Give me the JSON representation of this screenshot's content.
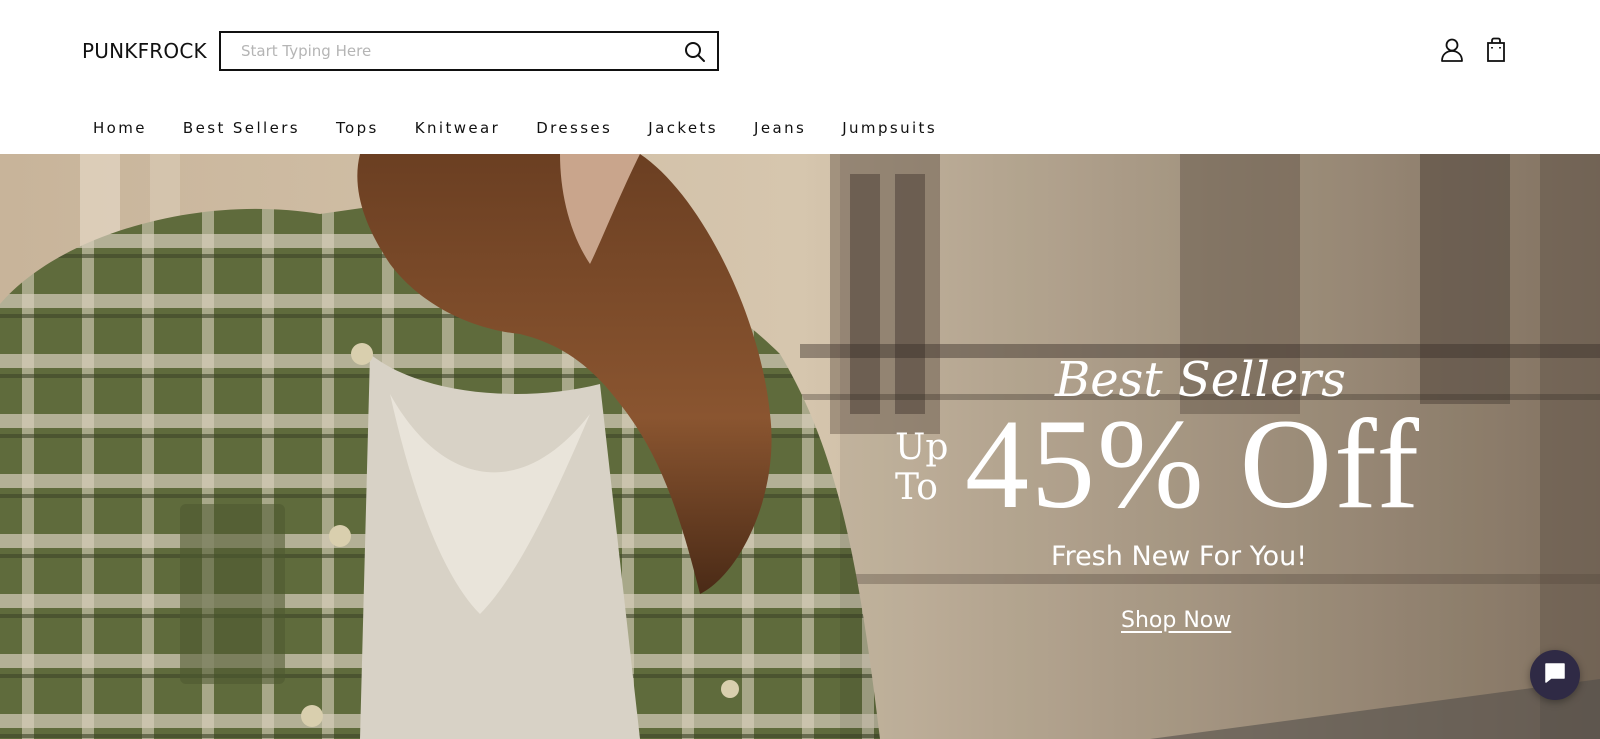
{
  "header": {
    "logo": "PUNKFROCK",
    "search": {
      "placeholder": "Start Typing Here",
      "value": ""
    }
  },
  "icons": {
    "search": "search-icon",
    "account": "user-icon",
    "cart": "shopping-bag-icon",
    "chat": "chat-icon"
  },
  "nav": {
    "items": [
      {
        "label": "Home"
      },
      {
        "label": "Best Sellers"
      },
      {
        "label": "Tops"
      },
      {
        "label": "Knitwear"
      },
      {
        "label": "Dresses"
      },
      {
        "label": "Jackets"
      },
      {
        "label": "Jeans"
      },
      {
        "label": "Jumpsuits"
      }
    ]
  },
  "hero": {
    "kicker": "Best Sellers",
    "upto_line1": "Up",
    "upto_line2": "To",
    "discount": "45% Off",
    "subtitle": "Fresh New For You!",
    "cta": "Shop Now"
  },
  "colors": {
    "text": "#111111",
    "hero_text": "#ffffff",
    "chat_bg": "#2f2a45",
    "jacket_green": "#5f6b3c"
  }
}
